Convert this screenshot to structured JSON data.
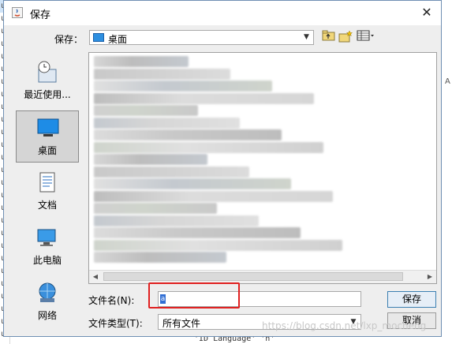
{
  "window": {
    "title": "保存"
  },
  "toolbar": {
    "save_in_label": "保存：",
    "location_value": "桌面"
  },
  "places": [
    {
      "label": "最近使用...",
      "icon": "recent-items-icon"
    },
    {
      "label": "桌面",
      "icon": "desktop-icon",
      "selected": true
    },
    {
      "label": "文档",
      "icon": "documents-icon"
    },
    {
      "label": "此电脑",
      "icon": "computer-icon"
    },
    {
      "label": "网络",
      "icon": "network-icon"
    }
  ],
  "form": {
    "file_name_label": "文件名(N):",
    "file_name_value": "",
    "file_type_label": "文件类型(T):",
    "file_type_value": "所有文件"
  },
  "buttons": {
    "save": "保存",
    "cancel": "取消"
  },
  "background": {
    "left_glyphs": [
      "u",
      "u",
      "u",
      "u",
      "u",
      "u",
      "u",
      "u",
      "u",
      "u",
      "u",
      "u",
      "u",
      "u",
      "u",
      "u",
      "u",
      "u",
      "u",
      "u",
      "u",
      "u",
      "u",
      "u",
      "u",
      "u",
      "u"
    ],
    "right_text": "A",
    "bottom_text": "'ID Language' 'n'"
  },
  "watermark": "https://blog.csdn.net/lxp_mocheng",
  "colors": {
    "highlight": "#e02020",
    "accent": "#3370d4"
  }
}
